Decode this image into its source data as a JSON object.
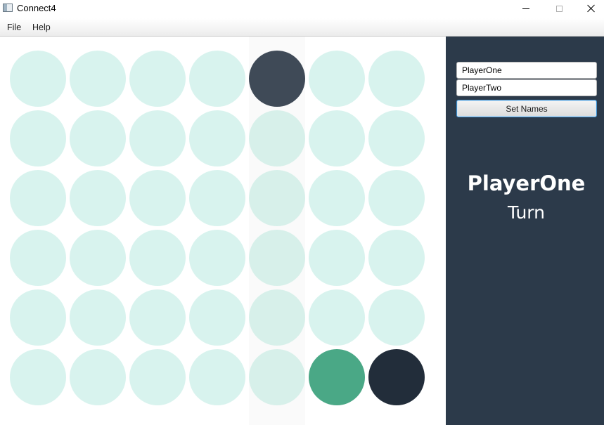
{
  "window": {
    "title": "Connect4",
    "icon": "app-window-icon",
    "controls": [
      "minimize-icon",
      "maximize-icon",
      "close-icon"
    ]
  },
  "menu": {
    "items": [
      "File",
      "Help"
    ]
  },
  "board": {
    "rows": 6,
    "columns": 7,
    "highlighted_column": 4,
    "colors": {
      "empty": "#d8f3ee",
      "empty_highlighted": "#d7f0ea",
      "player_one": "#222d3a",
      "player_one_preview": "#3f4a57",
      "player_two": "#4aa886"
    },
    "cells": [
      [
        "empty",
        "empty",
        "empty",
        "empty",
        "preview",
        "empty",
        "empty"
      ],
      [
        "empty",
        "empty",
        "empty",
        "empty",
        "empty",
        "empty",
        "empty"
      ],
      [
        "empty",
        "empty",
        "empty",
        "empty",
        "empty",
        "empty",
        "empty"
      ],
      [
        "empty",
        "empty",
        "empty",
        "empty",
        "empty",
        "empty",
        "empty"
      ],
      [
        "empty",
        "empty",
        "empty",
        "empty",
        "empty",
        "empty",
        "empty"
      ],
      [
        "empty",
        "empty",
        "empty",
        "empty",
        "empty",
        "player_two",
        "player_one"
      ]
    ]
  },
  "side_panel": {
    "background": "#2c3a4a",
    "player_one_value": "PlayerOne",
    "player_two_value": "PlayerTwo",
    "set_names_label": "Set Names",
    "current_player": "PlayerOne",
    "turn_label": "Turn"
  }
}
